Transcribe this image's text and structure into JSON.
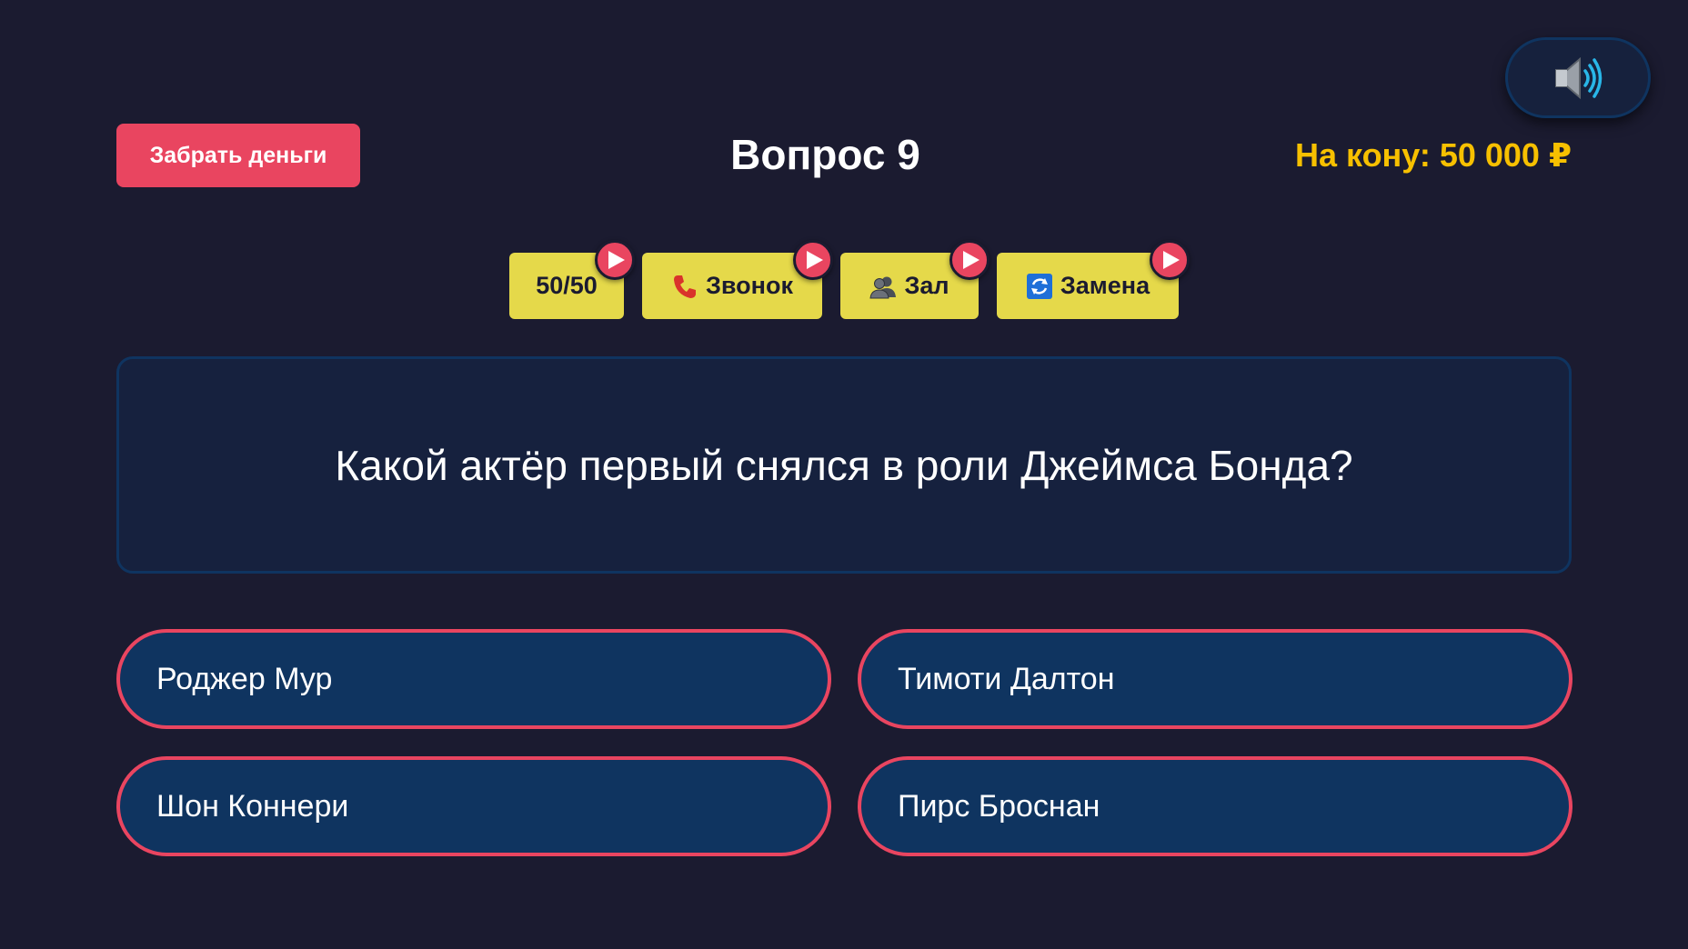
{
  "sound": {
    "icon": "speaker-sound-on-icon"
  },
  "header": {
    "take_money_label": "Забрать деньги",
    "question_number": "Вопрос 9",
    "bank": "На кону: 50 000 ₽"
  },
  "lifelines": [
    {
      "label": "50/50",
      "icon": "",
      "badge_icon": "play-icon"
    },
    {
      "label": "Звонок",
      "icon": "phone-icon",
      "badge_icon": "play-icon"
    },
    {
      "label": "Зал",
      "icon": "audience-icon",
      "badge_icon": "play-icon"
    },
    {
      "label": "Замена",
      "icon": "swap-icon",
      "badge_icon": "play-icon"
    }
  ],
  "question": {
    "text": "Какой актёр первый снялся в роли Джеймса Бонда?"
  },
  "answers": [
    {
      "text": "Роджер Мур"
    },
    {
      "text": "Тимоти Далтон"
    },
    {
      "text": "Шон Коннери"
    },
    {
      "text": "Пирс Броснан"
    }
  ],
  "colors": {
    "background": "#1b1b30",
    "accent": "#e94560",
    "lifeline": "#e5d94a",
    "bank": "#f7c000",
    "answer_bg": "#0f3460"
  }
}
